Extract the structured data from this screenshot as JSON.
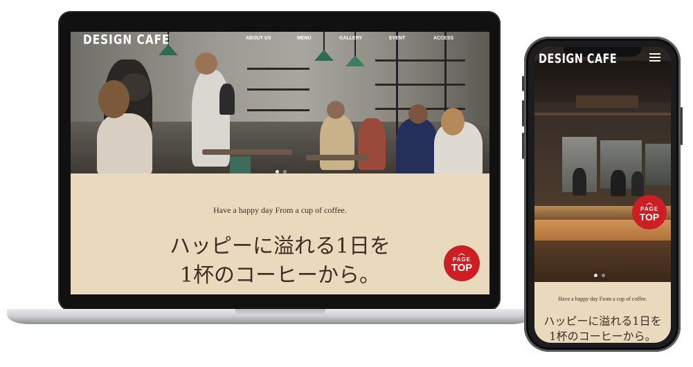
{
  "laptop": {
    "logo": "DESIGN CAFE",
    "nav": [
      "ABOUT US",
      "MENU",
      "GALLERY",
      "EVENT",
      "ACCESS"
    ],
    "tagline": "Have a happy day From a cup of coffee.",
    "headline_line1": "ハッピーに溢れる1日を",
    "headline_line2": "1杯のコーヒーから。",
    "page_top": {
      "small": "PAGE",
      "big": "TOP"
    }
  },
  "phone": {
    "logo": "DESIGN CAFE",
    "tagline": "Have a happy day From a cup of coffee.",
    "headline_line1": "ハッピーに溢れる1日を",
    "headline_line2": "1杯のコーヒーから。",
    "page_top": {
      "small": "PAGE",
      "big": "TOP"
    }
  },
  "colors": {
    "cream": "#e9d9bd",
    "page_top_red": "#cc1e23",
    "headline_brown": "#3e2d22"
  },
  "icons": [
    "chevron-up-icon",
    "hamburger-menu-icon"
  ]
}
